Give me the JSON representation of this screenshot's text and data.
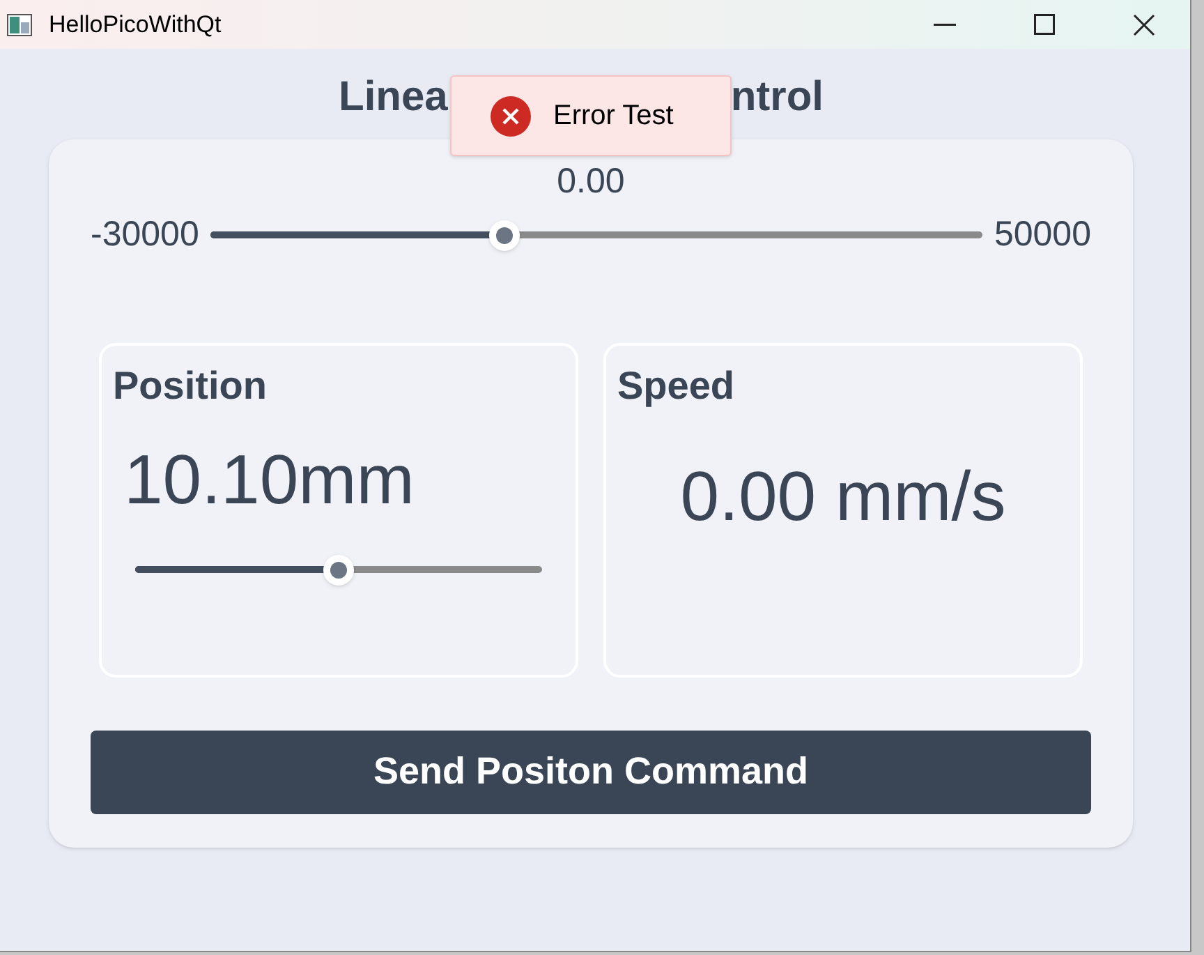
{
  "window": {
    "title": "HelloPicoWithQt"
  },
  "heading": {
    "visible_start": "Linea",
    "visible_end": "ntrol"
  },
  "toast": {
    "kind": "error",
    "message": "Error Test"
  },
  "range_slider": {
    "value": "0.00",
    "min": "-30000",
    "max": "50000",
    "level": 0.38
  },
  "position": {
    "title": "Position",
    "value": "10.10mm",
    "level": 0.5
  },
  "speed": {
    "title": "Speed",
    "value": "0.00 mm/s"
  },
  "send_button": {
    "label": "Send Positon Command"
  }
}
